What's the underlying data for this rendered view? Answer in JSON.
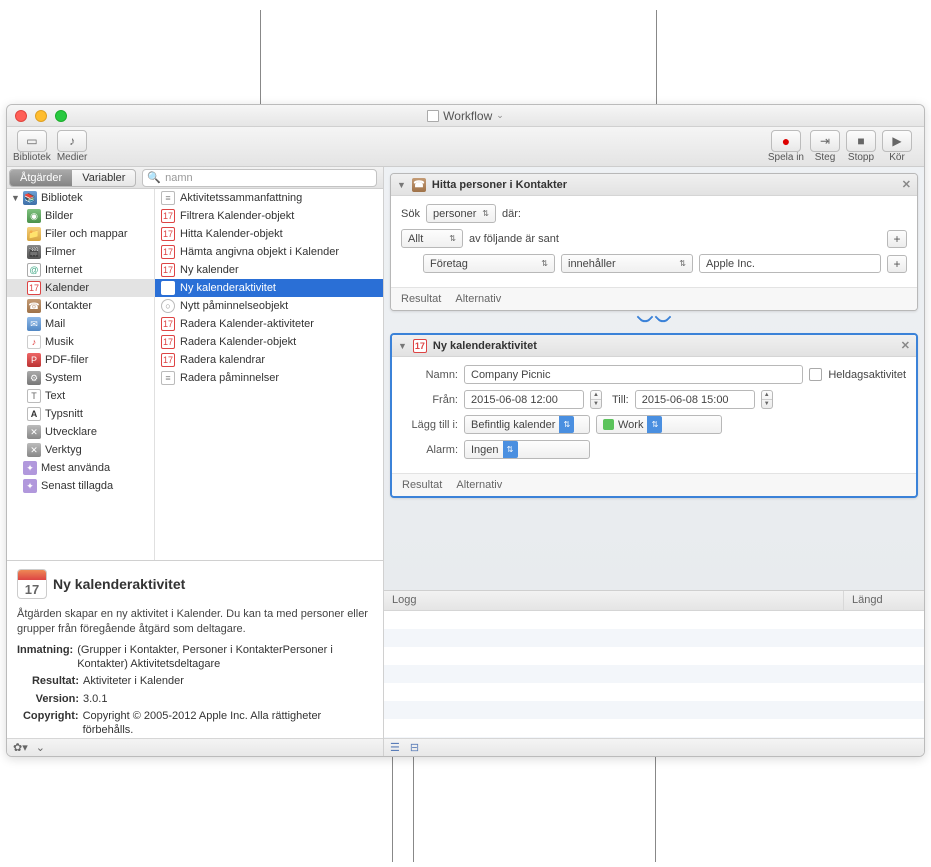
{
  "title": "Workflow",
  "toolbar": {
    "library": "Bibliotek",
    "media": "Medier",
    "record": "Spela in",
    "step": "Steg",
    "stop": "Stopp",
    "run": "Kör"
  },
  "tabs": {
    "actions": "Åtgärder",
    "variables": "Variabler"
  },
  "search_placeholder": "namn",
  "library_root": "Bibliotek",
  "categories": [
    "Bilder",
    "Filer och mappar",
    "Filmer",
    "Internet",
    "Kalender",
    "Kontakter",
    "Mail",
    "Musik",
    "PDF-filer",
    "System",
    "Text",
    "Typsnitt",
    "Utvecklare",
    "Verktyg"
  ],
  "smart": [
    "Mest använda",
    "Senast tillagda"
  ],
  "actions": [
    "Aktivitetssammanfattning",
    "Filtrera Kalender-objekt",
    "Hitta Kalender-objekt",
    "Hämta angivna objekt i Kalender",
    "Ny kalender",
    "Ny kalenderaktivitet",
    "Nytt påminnelseobjekt",
    "Radera Kalender-aktiviteter",
    "Radera Kalender-objekt",
    "Radera kalendrar",
    "Radera påminnelser"
  ],
  "selected_action_index": 5,
  "info": {
    "title": "Ny kalenderaktivitet",
    "desc": "Åtgärden skapar en ny aktivitet i Kalender. Du kan ta med personer eller grupper från föregående åtgärd som deltagare.",
    "input_label": "Inmatning:",
    "input_value": "(Grupper i Kontakter, Personer i KontakterPersoner i Kontakter) Aktivitetsdeltagare",
    "result_label": "Resultat:",
    "result_value": "Aktiviteter i Kalender",
    "version_label": "Version:",
    "version_value": "3.0.1",
    "copy_label": "Copyright:",
    "copy_value": "Copyright © 2005-2012 Apple Inc. Alla rättigheter förbehålls.",
    "cal_num": "17"
  },
  "card1": {
    "title": "Hitta personer i Kontakter",
    "search_label": "Sök",
    "search_type": "personer",
    "where": "där:",
    "all": "Allt",
    "following": "av följande är sant",
    "field": "Företag",
    "op": "innehåller",
    "value": "Apple Inc.",
    "result": "Resultat",
    "options": "Alternativ"
  },
  "card2": {
    "title": "Ny kalenderaktivitet",
    "name_label": "Namn:",
    "name_value": "Company Picnic",
    "allday": "Heldagsaktivitet",
    "from_label": "Från:",
    "from_value": "2015-06-08 12:00",
    "to_label": "Till:",
    "to_value": "2015-06-08 15:00",
    "addto_label": "Lägg till i:",
    "addto_value": "Befintlig kalender",
    "calendar": "Work",
    "alarm_label": "Alarm:",
    "alarm_value": "Ingen",
    "result": "Resultat",
    "options": "Alternativ"
  },
  "log": {
    "col1": "Logg",
    "col2": "Längd"
  }
}
